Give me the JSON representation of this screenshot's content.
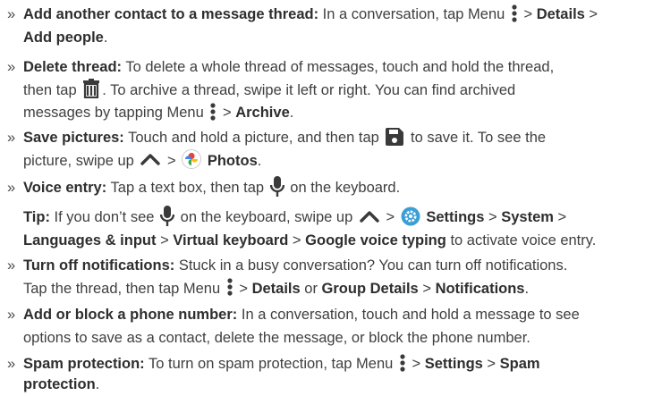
{
  "items": {
    "add_contact": {
      "title": "Add another contact to a message thread:",
      "t1": "In a conversation, tap Menu",
      "t2": ">",
      "b1": "Details",
      "t3": ">",
      "b2": "Add people",
      "t4": "."
    },
    "delete_thread": {
      "title": "Delete thread:",
      "t1": "To delete a whole thread of messages, touch and hold the thread,",
      "t2": "then tap",
      "t3": ". To archive a thread, swipe it left or right. You can find archived",
      "t4": "messages by tapping Menu",
      "t5": ">",
      "b1": "Archive",
      "t6": "."
    },
    "save_pictures": {
      "title": "Save pictures:",
      "t1": "Touch and hold a picture, and then tap",
      "t2": "to save it. To see the",
      "t3": "picture, swipe up",
      "t4": ">",
      "b1": "Photos",
      "t5": "."
    },
    "voice_entry": {
      "title": "Voice entry:",
      "t1": "Tap a text box, then tap",
      "t2": "on the keyboard."
    },
    "tip": {
      "title": "Tip:",
      "t1": "If you don’t see",
      "t2": "on the keyboard, swipe up",
      "t3": ">",
      "b1": "Settings",
      "t4": ">",
      "b2": "System",
      "t5": ">",
      "b3": "Languages & input",
      "t6": ">",
      "b4": "Virtual keyboard",
      "t7": ">",
      "b5": "Google voice typing",
      "t8": "to activate voice entry."
    },
    "turn_off": {
      "title": "Turn off notifications:",
      "t1": "Stuck in a busy conversation? You can turn off notifications.",
      "t2": "Tap the thread, then tap Menu",
      "t3": ">",
      "b1": "Details",
      "t4": "or",
      "b2": "Group Details",
      "t5": ">",
      "b3": "Notifications",
      "t6": "."
    },
    "block": {
      "title": "Add or block a phone number:",
      "t1": "In a conversation, touch and hold a message to see",
      "t2": "options to save as a contact, delete the message, or block the phone number."
    },
    "spam": {
      "title": "Spam protection:",
      "t1": "To turn on spam protection, tap Menu",
      "t2": ">",
      "b1": "Settings",
      "t3": ">",
      "b2": "Spam",
      "b3": "protection",
      "t4": "."
    }
  },
  "bullet": "»",
  "icons": [
    "menu-dots-icon",
    "trash-icon",
    "save-icon",
    "microphone-icon",
    "swipe-up-chevron-icon",
    "photos-app-icon",
    "settings-app-icon"
  ],
  "colors": {
    "text": "#3f3f3f",
    "bold": "#2e2e2e",
    "icon": "#3a3a3a"
  }
}
